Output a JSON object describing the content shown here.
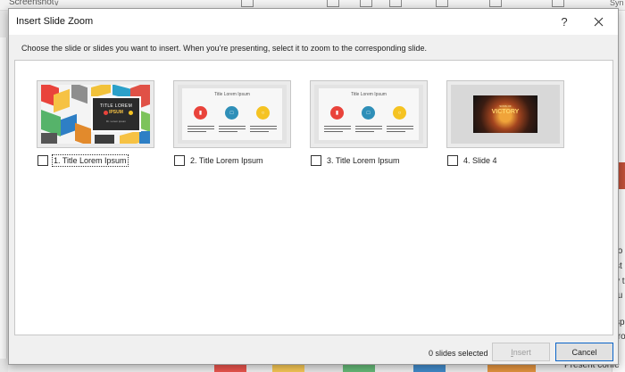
{
  "background_app": {
    "ribbon_label": "Screenshot",
    "ribbon_chevron": "∨",
    "ribbon_right_text": "Syn",
    "right_pane_letters": [
      "r",
      "fo",
      "st",
      "y t",
      "tu",
      "sp",
      "fro"
    ],
    "bottom_right_text": "Present confe"
  },
  "dialog": {
    "title": "Insert Slide Zoom",
    "help_label": "?",
    "close_icon": "close-icon",
    "instruction": "Choose the slide or slides you want to insert. When you're presenting, select it to zoom to the corresponding slide.",
    "slides": [
      {
        "label": "1. Title Lorem Ipsum",
        "checked": false,
        "focused": true,
        "thumb": {
          "title": "TITLE LOREM",
          "subtitle": "IPSUM",
          "small": "Dr. Lorem ipsum"
        }
      },
      {
        "label": "2. Title Lorem Ipsum",
        "checked": false,
        "focused": false,
        "thumb": {
          "title": "Title Lorem Ipsum"
        }
      },
      {
        "label": "3. Title Lorem Ipsum",
        "checked": false,
        "focused": false,
        "thumb": {
          "title": "Title Lorem Ipsum"
        }
      },
      {
        "label": "4. Slide 4",
        "checked": false,
        "focused": false,
        "thumb": {
          "caption_small": "SONS OF",
          "caption_big": "VICTORY"
        }
      }
    ],
    "status": "0 slides selected",
    "insert_button": {
      "label_underlined": "I",
      "label_rest": "nsert",
      "enabled": false
    },
    "cancel_button": {
      "label": "Cancel"
    }
  },
  "colors": {
    "dialog_bg": "#f0f0f0",
    "panel_bg": "#ffffff",
    "accent_red": "#e9433b",
    "accent_teal": "#2f8fb8",
    "accent_yellow": "#f5c322",
    "focus_border": "#0a64c8"
  }
}
